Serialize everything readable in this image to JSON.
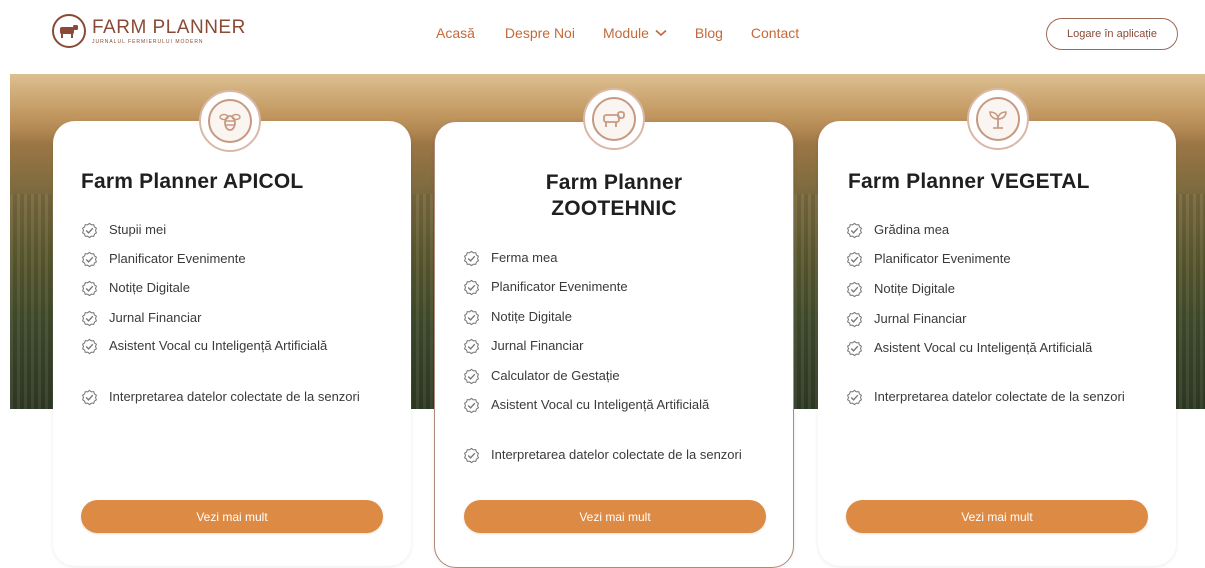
{
  "brand": {
    "name": "FARM PLANNER",
    "tagline": "JURNALUL FERMIERULUI MODERN"
  },
  "nav": {
    "items": [
      {
        "label": "Acasă"
      },
      {
        "label": "Despre Noi"
      },
      {
        "label": "Module"
      },
      {
        "label": "Blog"
      },
      {
        "label": "Contact"
      }
    ],
    "login_label": "Logare în aplicație"
  },
  "cards": [
    {
      "icon": "bee-icon",
      "title": "Farm Planner APICOL",
      "features": [
        "Stupii mei",
        "Planificator Evenimente",
        "Notițe Digitale",
        "Jurnal Financiar",
        "Asistent Vocal cu Inteligență Artificială",
        "Interpretarea datelor colectate de la senzori"
      ],
      "button": "Vezi mai mult"
    },
    {
      "icon": "cow-icon",
      "title_line1": "Farm Planner",
      "title_line2": "ZOOTEHNIC",
      "features": [
        "Ferma mea",
        "Planificator Evenimente",
        "Notițe Digitale",
        "Jurnal Financiar",
        "Calculator de Gestație",
        "Asistent Vocal cu Inteligență Artificială",
        "Interpretarea datelor colectate de la senzori"
      ],
      "button": "Vezi mai mult"
    },
    {
      "icon": "sprout-icon",
      "title": "Farm Planner VEGETAL",
      "features": [
        "Grădina mea",
        "Planificator Evenimente",
        "Notițe Digitale",
        "Jurnal Financiar",
        "Asistent Vocal cu Inteligență Artificială",
        "Interpretarea datelor colectate de la senzori"
      ],
      "button": "Vezi mai mult"
    }
  ],
  "colors": {
    "brand": "#8a4a37",
    "nav": "#c3693a",
    "button": "#dc8a44"
  }
}
